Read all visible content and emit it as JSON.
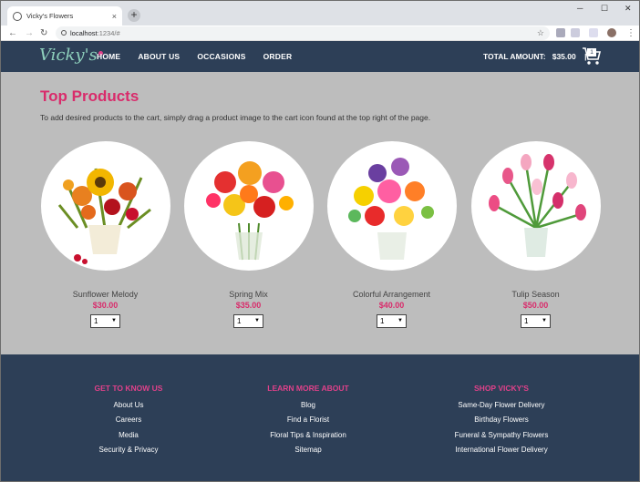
{
  "browser": {
    "tab_title": "Vicky's Flowers",
    "tab_close": "×",
    "new_tab": "+",
    "url_host": "localhost",
    "url_rest": ":1234/#",
    "controls": {
      "back": "←",
      "forward": "→",
      "reload": "↻",
      "minimize": "─",
      "maximize": "☐",
      "close": "✕",
      "star": "☆",
      "menu": "⋮"
    }
  },
  "header": {
    "logo": "Vicky's",
    "nav": [
      "HOME",
      "ABOUT US",
      "OCCASIONS",
      "ORDER"
    ],
    "total_label": "TOTAL AMOUNT:",
    "total_value": "$35.00",
    "separator": "|",
    "cart_count": "1"
  },
  "main": {
    "title": "Top Products",
    "description": "To add desired products to the cart, simply drag a product image to the cart icon found at the top right of the page.",
    "products": [
      {
        "name": "Sunflower Melody",
        "price": "$30.00",
        "qty": "1"
      },
      {
        "name": "Spring Mix",
        "price": "$35.00",
        "qty": "1"
      },
      {
        "name": "Colorful Arrangement",
        "price": "$40.00",
        "qty": "1"
      },
      {
        "name": "Tulip Season",
        "price": "$50.00",
        "qty": "1"
      }
    ]
  },
  "footer": {
    "columns": [
      {
        "heading": "GET TO KNOW US",
        "links": [
          "About Us",
          "Careers",
          "Media",
          "Security & Privacy"
        ]
      },
      {
        "heading": "LEARN MORE ABOUT",
        "links": [
          "Blog",
          "Find a Florist",
          "Floral Tips & Inspiration",
          "Sitemap"
        ]
      },
      {
        "heading": "SHOP VICKY'S",
        "links": [
          "Same-Day Flower Delivery",
          "Birthday Flowers",
          "Funeral & Sympathy Flowers",
          "International Flower Delivery"
        ]
      }
    ]
  },
  "colors": {
    "header_bg": "#2d3f57",
    "accent_pink": "#d92b6b",
    "content_bg": "#bdbdbd",
    "logo_green": "#8fd1bd"
  }
}
